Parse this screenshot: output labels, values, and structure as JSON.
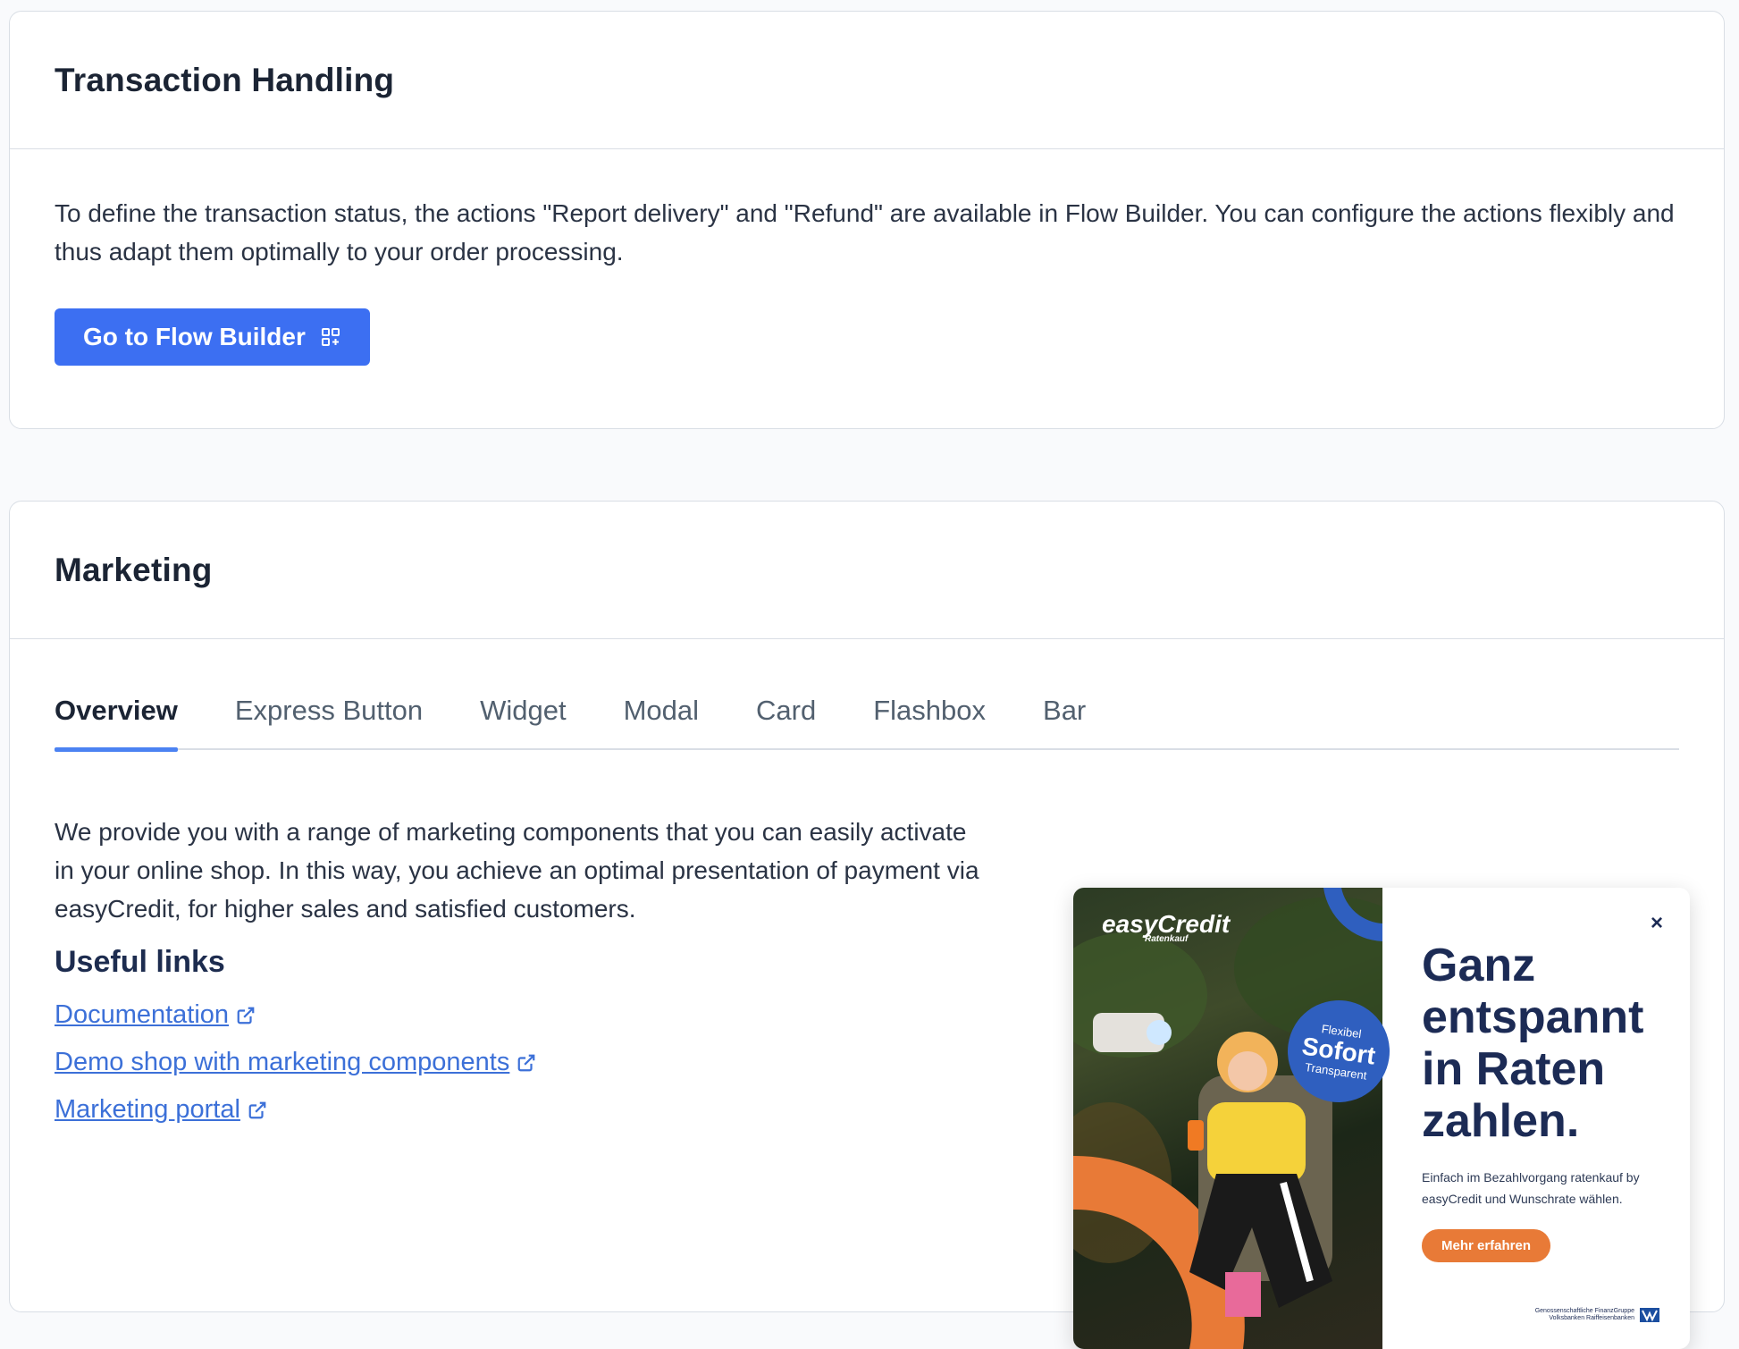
{
  "transaction": {
    "title": "Transaction Handling",
    "description": "To define the transaction status, the actions \"Report delivery\" and \"Refund\" are available in Flow Builder. You can configure the actions flexibly and thus adapt them optimally to your order processing.",
    "button_label": "Go to Flow Builder",
    "button_icon": "flow-builder-icon"
  },
  "marketing": {
    "title": "Marketing",
    "tabs": [
      {
        "label": "Overview",
        "active": true
      },
      {
        "label": "Express Button",
        "active": false
      },
      {
        "label": "Widget",
        "active": false
      },
      {
        "label": "Modal",
        "active": false
      },
      {
        "label": "Card",
        "active": false
      },
      {
        "label": "Flashbox",
        "active": false
      },
      {
        "label": "Bar",
        "active": false
      }
    ],
    "overview_text": "We provide you with a range of marketing components that you can easily activate in your online shop. In this way, you achieve an optimal presentation of payment via easyCredit, for higher sales and satisfied customers.",
    "useful_links_title": "Useful links",
    "links": [
      {
        "label": "Documentation",
        "icon": "external-link-icon"
      },
      {
        "label": "Demo shop with marketing components",
        "icon": "external-link-icon"
      },
      {
        "label": "Marketing portal",
        "icon": "external-link-icon"
      }
    ],
    "banner": {
      "logo_main": "easyCredit",
      "logo_sub": "Ratenkauf",
      "badge_top": "Flexibel",
      "badge_main": "Sofort",
      "badge_bottom": "Transparent",
      "headline": "Ganz entspannt in Raten zahlen.",
      "subtext": "Einfach im Bezahlvorgang ratenkauf by easyCredit und Wunschrate wählen.",
      "cta": "Mehr erfahren",
      "close_symbol": "×",
      "bank_line1": "Genossenschaftliche FinanzGruppe",
      "bank_line2": "Volksbanken Raiffeisenbanken"
    }
  },
  "colors": {
    "primary_button": "#3c6ff2",
    "link": "#3c70d8",
    "tab_indicator": "#4b82f2",
    "banner_headline": "#1c2b55",
    "banner_cta": "#e87a37",
    "banner_badge": "#2f5fbf"
  }
}
